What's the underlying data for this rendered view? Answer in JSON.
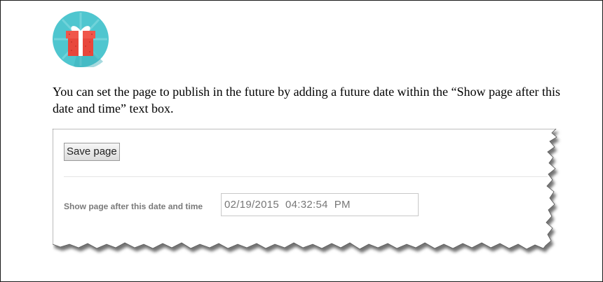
{
  "intro_text": "You can set the page to publish in the future by adding a future date within the “Show page after this date and time” text box.",
  "icon": {
    "name": "gift-icon",
    "colors": {
      "badge": "#4fc6cf",
      "box": "#e8473c",
      "ribbon": "#ffffff"
    }
  },
  "screenshot": {
    "save_button_label": "Save page",
    "date_label": "Show page after this date and time",
    "date_value": "02/19/2015  04:32:54  PM"
  }
}
